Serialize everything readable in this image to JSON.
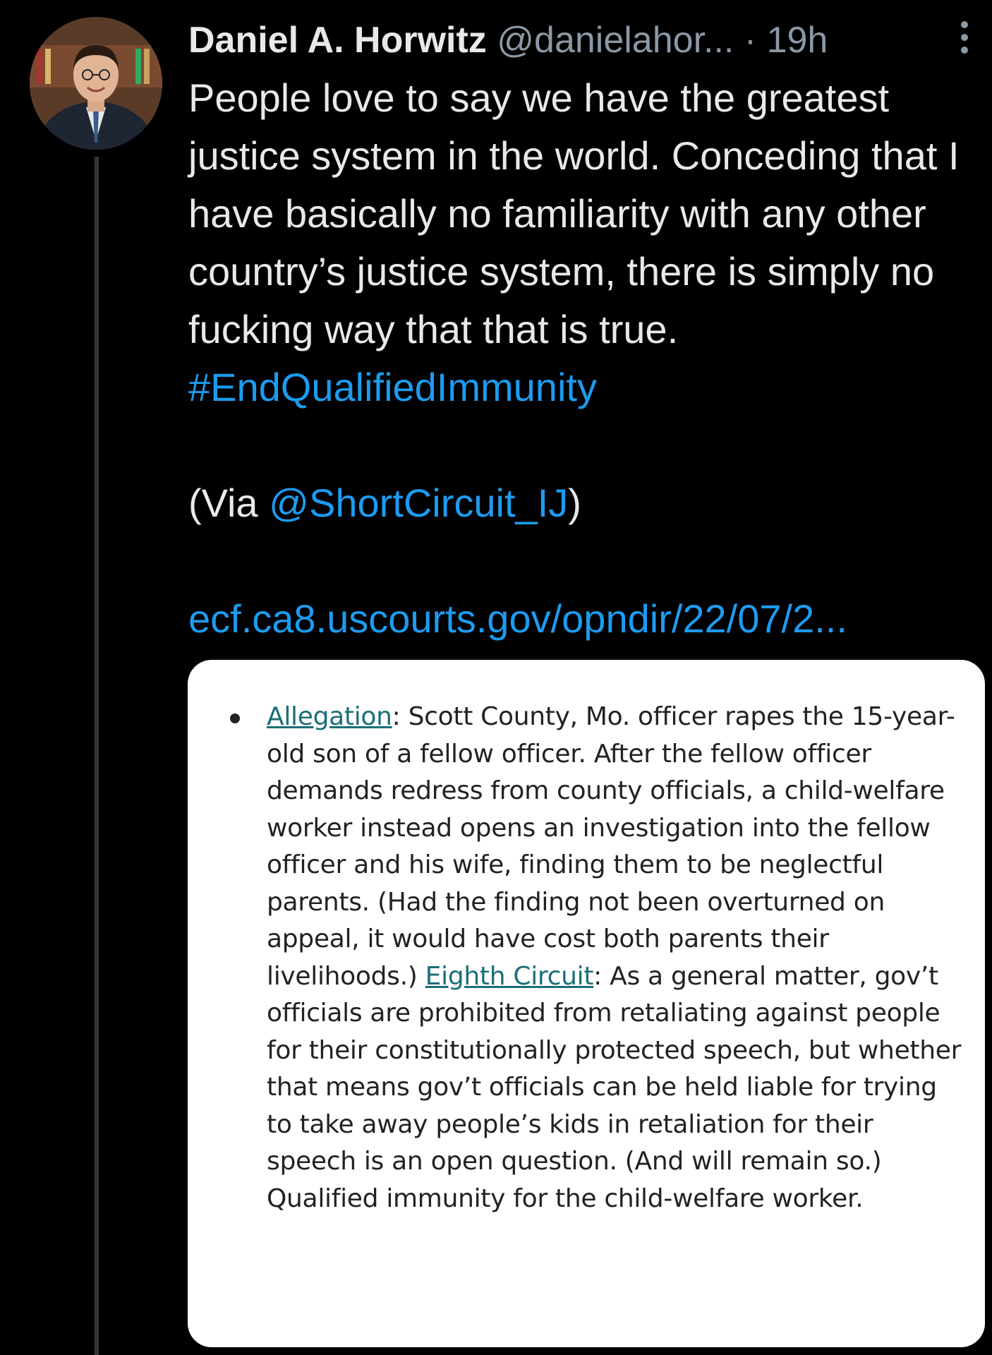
{
  "tweet": {
    "author_name": "Daniel A. Horwitz",
    "author_handle": "@danielahor...",
    "separator": " · ",
    "time": "19h",
    "text_main": "People love to say we have the greatest justice system in the world.  Conceding that I have basically no familiarity with any other country’s justice system, there is simply no fucking way that that is true.",
    "hashtag": "#EndQualifiedImmunity",
    "via_prefix": "(Via ",
    "via_handle": "@ShortCircuit_IJ",
    "via_suffix": ")",
    "url": "ecf.ca8.uscourts.gov/opndir/22/07/2..."
  },
  "card": {
    "allegation_link": "Allegation",
    "allegation_text": ": Scott County, Mo. officer rapes the 15-year-old son of a fellow officer. After the fellow officer demands redress from county officials, a child-welfare worker instead opens an investigation into the fellow officer and his wife, finding them to be neglectful parents. (Had the finding not been overturned on appeal, it would have cost both parents their livelihoods.) ",
    "court_link": "Eighth Circuit",
    "court_text": ": As a general matter, gov’t officials are prohibited from retaliating against people for their constitutionally protected speech, but whether that means gov’t officials can be held liable for trying to take away people’s kids in retaliation for their speech is an open question. (And will remain so.) Qualified immunity for the child-welfare worker."
  },
  "icons": {
    "avatar": "avatar-photo",
    "more": "more-options-icon"
  },
  "colors": {
    "background": "#000000",
    "text": "#e7e9ea",
    "secondary": "#8b98a5",
    "link": "#1d9bf0",
    "card_link": "#1a6f78"
  }
}
